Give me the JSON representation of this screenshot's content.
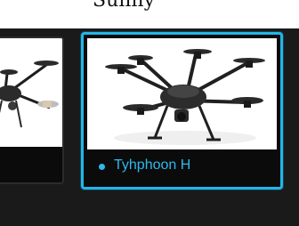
{
  "drones": [
    {
      "name": "",
      "selected": false
    },
    {
      "name": "Tyhphoon H",
      "selected": true,
      "status_color": "#2fb9ea"
    }
  ],
  "header_fragment": "Sunny",
  "accent_color": "#22b6e8"
}
